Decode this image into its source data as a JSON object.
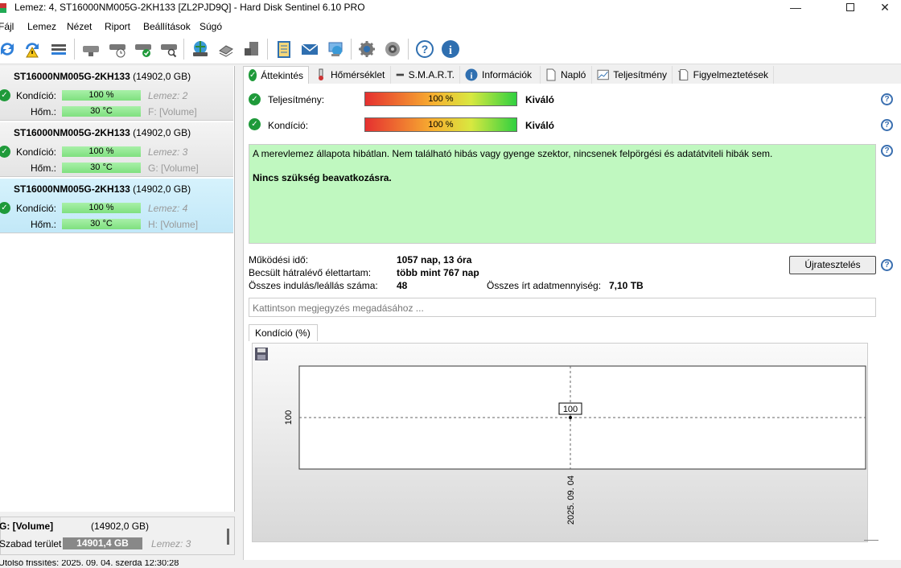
{
  "window": {
    "title": "Lemez: 4, ST16000NM005G-2KH133 [ZL2PJD9Q]  -  Hard Disk Sentinel 6.10 PRO"
  },
  "menu": [
    "Fájl",
    "Lemez",
    "Nézet",
    "Riport",
    "Beállítások",
    "Súgó"
  ],
  "disks": [
    {
      "name": "ST16000NM005G-2KH133",
      "size": "(14902,0 GB)",
      "cond_label": "Kondíció:",
      "cond": "100 %",
      "disk": "Lemez: 2",
      "temp_label": "Hőm.:",
      "temp": "30 °C",
      "volume": "F: [Volume]"
    },
    {
      "name": "ST16000NM005G-2KH133",
      "size": "(14902,0 GB)",
      "cond_label": "Kondíció:",
      "cond": "100 %",
      "disk": "Lemez: 3",
      "temp_label": "Hőm.:",
      "temp": "30 °C",
      "volume": "G: [Volume]"
    },
    {
      "name": "ST16000NM005G-2KH133",
      "size": "(14902,0 GB)",
      "cond_label": "Kondíció:",
      "cond": "100 %",
      "disk": "Lemez: 4",
      "temp_label": "Hőm.:",
      "temp": "30 °C",
      "volume": "H: [Volume]"
    }
  ],
  "volume_panel": {
    "name": "G: [Volume]",
    "size": "(14902,0 GB)",
    "free_label": "Szabad terület",
    "free": "14901,4 GB",
    "disk": "Lemez: 3"
  },
  "status_text": "Utolsó frissítés: 2025. 09. 04. szerda 12:30:28",
  "tabs": [
    "Áttekintés",
    "Hőmérséklet",
    "S.M.A.R.T.",
    "Információk",
    "Napló",
    "Teljesítmény",
    "Figyelmeztetések"
  ],
  "overview": {
    "perf_label": "Teljesítmény:",
    "perf_value": "100 %",
    "perf_level": 1.0,
    "perf_rating": "Kiváló",
    "health_label": "Kondíció:",
    "health_value": "100 %",
    "health_level": 1.0,
    "health_rating": "Kiváló",
    "message": "A merevlemez állapota hibátlan. Nem található hibás vagy gyenge szektor, nincsenek felpörgési és adatátviteli hibák sem.",
    "action": "Nincs szükség beavatkozásra.",
    "uptime_label": "Működési idő:",
    "uptime": "1057 nap, 13 óra",
    "remaining_label": "Becsült hátralévő élettartam:",
    "remaining": "több mint 767 nap",
    "starts_label": "Összes indulás/leállás száma:",
    "starts": "48",
    "written_label": "Összes írt adatmennyiség:",
    "written": "7,10 TB",
    "retest_button": "Újratesztelés",
    "note_placeholder": "Kattintson megjegyzés megadásához ..."
  },
  "chart_tab": "Kondíció  (%)",
  "chart_data": {
    "type": "line",
    "x": [
      "2025. 09. 04"
    ],
    "series": [
      {
        "values": [
          100
        ]
      }
    ],
    "title": "",
    "ylabel": "",
    "yticks": [
      "100"
    ],
    "data_labels": [
      "100"
    ],
    "grid": true
  },
  "colors": {
    "ok_green": "#1f9a3a",
    "message_bg": "#c0f8c0",
    "selected_disk_bg": "#cdeffc",
    "bar_green": "#7fe07f",
    "help_blue": "#3a6fb0"
  }
}
